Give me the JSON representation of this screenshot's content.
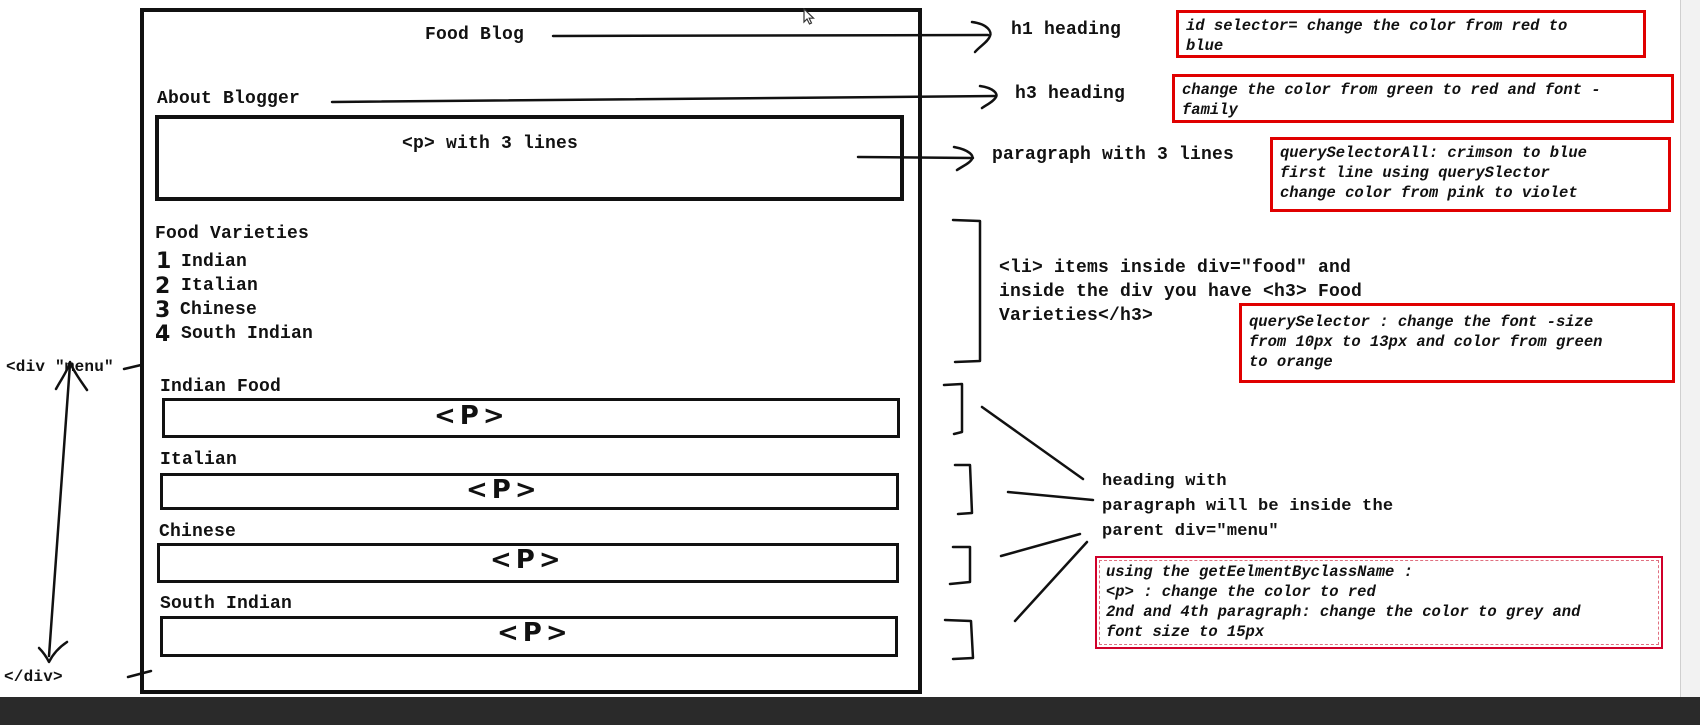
{
  "page": {
    "title": "Food Blog",
    "about": "About Blogger",
    "intro_placeholder": "<p> with 3 lines",
    "food_heading": "Food Varieties",
    "food_items": [
      {
        "num": "1",
        "label": "Indian"
      },
      {
        "num": "2",
        "label": "Italian"
      },
      {
        "num": "3",
        "label": "Chinese"
      },
      {
        "num": "4",
        "label": "South Indian"
      }
    ],
    "menu_sections": [
      {
        "heading": "Indian Food",
        "p": "<P>"
      },
      {
        "heading": "Italian",
        "p": "<P>"
      },
      {
        "heading": "Chinese",
        "p": "<P>"
      },
      {
        "heading": "South Indian",
        "p": "<P>"
      }
    ]
  },
  "left_labels": {
    "div_open": "<div \"menu\"",
    "div_close": "</div>"
  },
  "annotations": {
    "h1": "h1 heading",
    "h3": "h3 heading",
    "paragraph": "paragraph with 3 lines",
    "li_lines": [
      "<li> items inside div=\"food\" and",
      "inside the div you have <h3> Food",
      "Varieties</h3>"
    ],
    "menu_lines": [
      "heading with",
      "paragraph will be inside the",
      "parent div=\"menu\""
    ]
  },
  "notes": {
    "id_selector": [
      "id selector= change the color from red  to",
      "blue"
    ],
    "h3_change": [
      "change the color from green to red and font -",
      "family"
    ],
    "query_all": [
      "querySelectorAll: crimson to blue",
      "first line using querySlector",
      "change color from pink to violet"
    ],
    "query_selector": [
      "querySelector : change the font -size",
      "from 10px to 13px and color from green",
      "to orange"
    ],
    "class_name": [
      "using the getEelmentByclassName :",
      "<p> : change the color to red",
      "2nd and 4th paragraph: change the color to grey and",
      "font size to 15px"
    ]
  },
  "colors": {
    "ink": "#111111",
    "note_border": "#e00000",
    "taskbar": "#2a2a2a"
  },
  "icons": [
    "mouse-cursor-icon"
  ]
}
